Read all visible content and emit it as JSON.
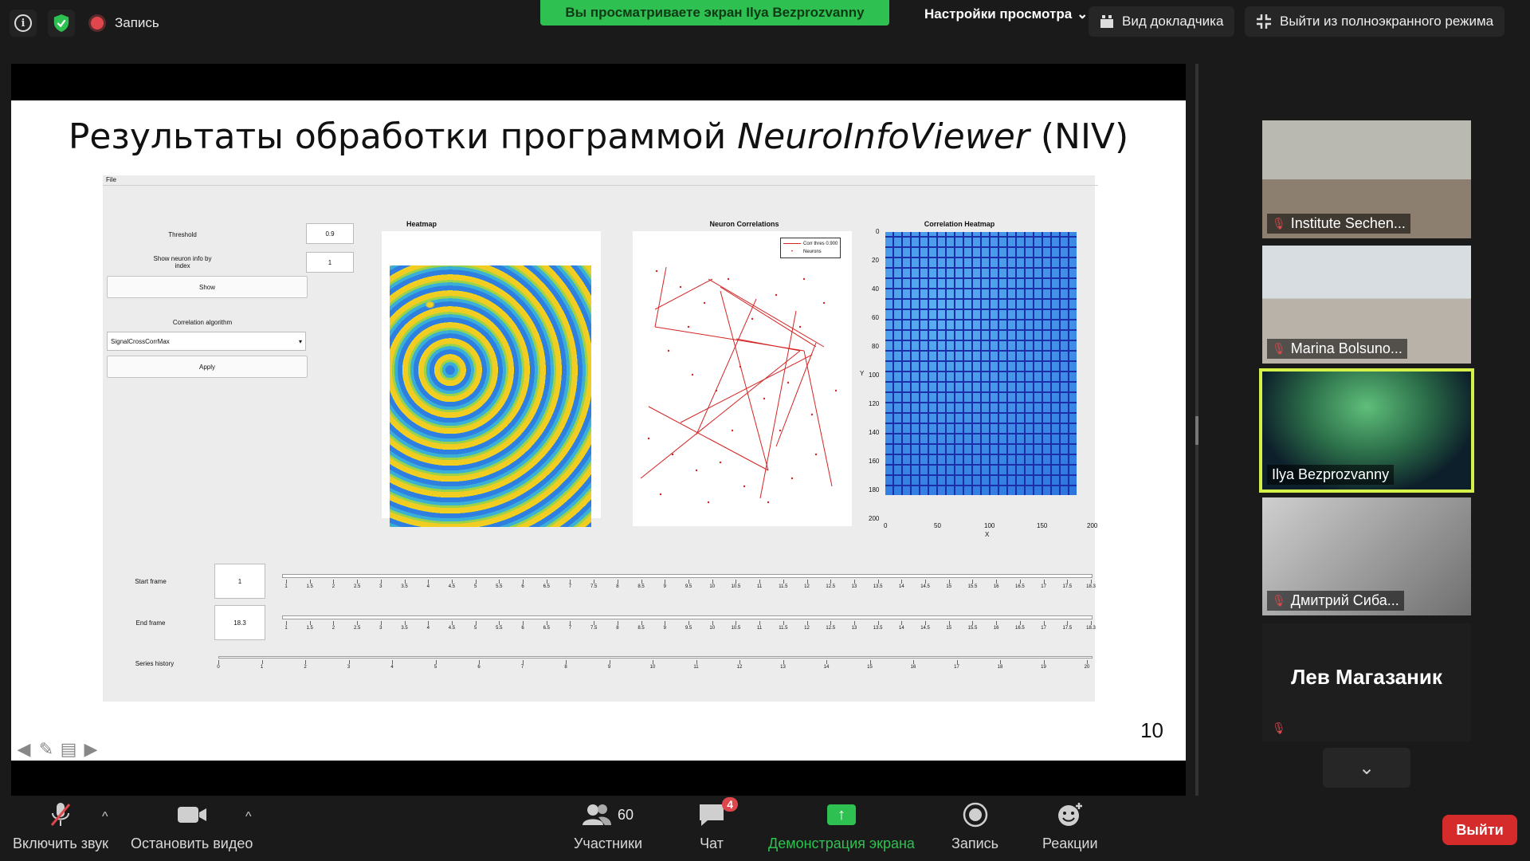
{
  "top": {
    "record_label": "Запись",
    "share_banner": "Вы просматриваете экран Ilya Bezprozvanny",
    "view_options": "Настройки просмотра",
    "speaker_view": "Вид докладчика",
    "exit_fullscreen": "Выйти из полноэкранного режима"
  },
  "slide": {
    "title_plain": "Результаты обработки программой ",
    "title_italic": "NeuroInfoViewer",
    "title_suffix": " (NIV)",
    "number": "10"
  },
  "app": {
    "menu_file": "File",
    "threshold_label": "Threshold",
    "threshold_value": "0.9",
    "show_info_label": "Show neuron info by index",
    "show_info_value": "1",
    "show_button": "Show",
    "corr_algo_label": "Correlation algorithm",
    "corr_algo_value": "SignalCrossCorrMax",
    "apply_button": "Apply",
    "heatmap_title": "Heatmap",
    "neuron_corr_title": "Neuron Correlations",
    "legend_line": "Corr thres 0.900",
    "legend_points": "Neurons",
    "corr_heatmap_title": "Correlation Heatmap",
    "x_axis_label": "X",
    "y_axis_label": "Y",
    "x_ticks": [
      "0",
      "50",
      "100",
      "150",
      "200"
    ],
    "y_ticks": [
      "0",
      "20",
      "40",
      "60",
      "80",
      "100",
      "120",
      "140",
      "160",
      "180",
      "200"
    ],
    "start_frame_label": "Start frame",
    "start_frame_value": "1",
    "end_frame_label": "End frame",
    "end_frame_value": "18.3",
    "series_history_label": "Series history",
    "frame_ticks": [
      "1",
      "1.5",
      "2",
      "2.5",
      "3",
      "3.5",
      "4",
      "4.5",
      "5",
      "5.5",
      "6",
      "6.5",
      "7",
      "7.5",
      "8",
      "8.5",
      "9",
      "9.5",
      "10",
      "10.5",
      "11",
      "11.5",
      "12",
      "12.5",
      "13",
      "13.5",
      "14",
      "14.5",
      "15",
      "15.5",
      "16",
      "16.5",
      "17",
      "17.5",
      "18.3"
    ],
    "history_ticks": [
      "0",
      "1",
      "2",
      "3",
      "4",
      "5",
      "6",
      "7",
      "8",
      "9",
      "10",
      "11",
      "12",
      "13",
      "14",
      "15",
      "16",
      "17",
      "18",
      "19",
      "20"
    ]
  },
  "participants": [
    {
      "name": "Institute Sechen...",
      "muted": true
    },
    {
      "name": "Marina Bolsuno...",
      "muted": true
    },
    {
      "name": "Ilya Bezprozvanny",
      "muted": false,
      "active": true
    },
    {
      "name": "Дмитрий Сиба...",
      "muted": true
    },
    {
      "name": "Лев Магазаник",
      "muted": true
    }
  ],
  "toolbar": {
    "unmute": "Включить звук",
    "stop_video": "Остановить видео",
    "participants": "Участники",
    "participants_count": "60",
    "chat": "Чат",
    "chat_badge": "4",
    "share_screen": "Демонстрация экрана",
    "record": "Запись",
    "reactions": "Реакции",
    "leave": "Выйти"
  },
  "colors": {
    "share_green": "#2ec050",
    "leave_red": "#d62b2b",
    "active_speaker": "#d4f14a"
  }
}
